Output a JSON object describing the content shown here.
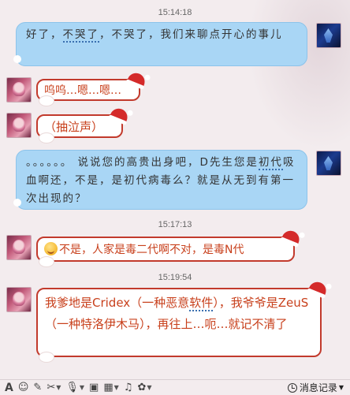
{
  "messages": {
    "t1": "15:14:18",
    "m1_pre": "好了，",
    "m1_link": "不哭了",
    "m1_post": "，不哭了，我们来聊点开心的事儿",
    "m2": "呜呜…嗯…嗯…",
    "m3": "（抽泣声）",
    "m4_pre": "。。。。。。 说说您的高贵出身吧，D先生您是",
    "m4_link": "初代",
    "m4_post": "吸血啊还，不是，是初代病毒么？就是从无到有第一次出现的？",
    "t2": "15:17:13",
    "m5": "不是，人家是毒二代啊不对，是毒N代",
    "t3": "15:19:54",
    "m6_pre": "我爹地是Cridex（一种恶意",
    "m6_link": "软件",
    "m6_post": "），我爷爷是ZeuS（一种特洛伊木马），再往上…呃…就记不清了"
  },
  "toolbar": {
    "history_label": "消息记录",
    "icons": [
      "font-icon",
      "emoji-icon",
      "magic-wand-icon",
      "screenshot-icon",
      "voice-icon",
      "image-icon",
      "photo-icon",
      "music-icon",
      "gift-icon"
    ]
  },
  "colors": {
    "blue_bubble": "#a9d6f5",
    "red_border": "#c23a2c",
    "red_text": "#c8401c",
    "background": "#f3ecee"
  }
}
